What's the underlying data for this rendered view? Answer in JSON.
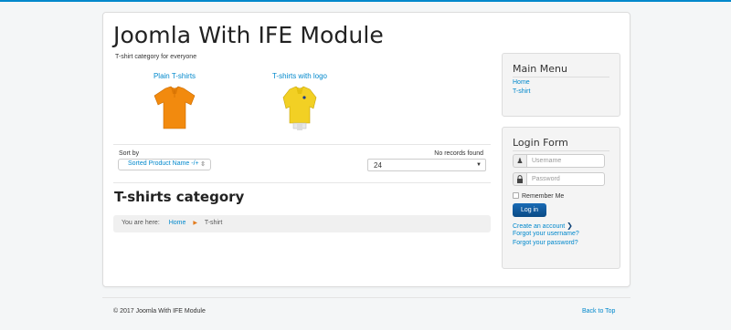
{
  "site": {
    "title": "Joomla With IFE Module",
    "description": "T-shirt category for everyone"
  },
  "categories": [
    {
      "label": "Plain T-shirts",
      "color": "#f28a0e",
      "icon": "orange-polo-shirt"
    },
    {
      "label": "T-shirts with logo",
      "color": "#f2d024",
      "icon": "yellow-polo-shirt-on-mannequin"
    }
  ],
  "sort": {
    "label": "Sort by",
    "selected": "Sorted Product Name -/+",
    "icon": "sort-icon"
  },
  "records_text": "No records found",
  "limit": {
    "selected": "24"
  },
  "category_heading": "T-shirts category",
  "breadcrumb": {
    "label": "You are here:",
    "home": "Home",
    "current": "T-shirt"
  },
  "main_menu": {
    "title": "Main Menu",
    "items": [
      "Home",
      "T-shirt"
    ]
  },
  "login": {
    "title": "Login Form",
    "username_placeholder": "Username",
    "password_placeholder": "Password",
    "remember": "Remember Me",
    "button": "Log in",
    "create_account": "Create an account",
    "forgot_username": "Forgot your username?",
    "forgot_password": "Forgot your password?"
  },
  "footer": {
    "copyright": "© 2017 Joomla With IFE Module",
    "back_to_top": "Back to Top"
  },
  "colors": {
    "link": "#0088cc",
    "button": "#0d5698",
    "top_bar": "#0088cc"
  }
}
